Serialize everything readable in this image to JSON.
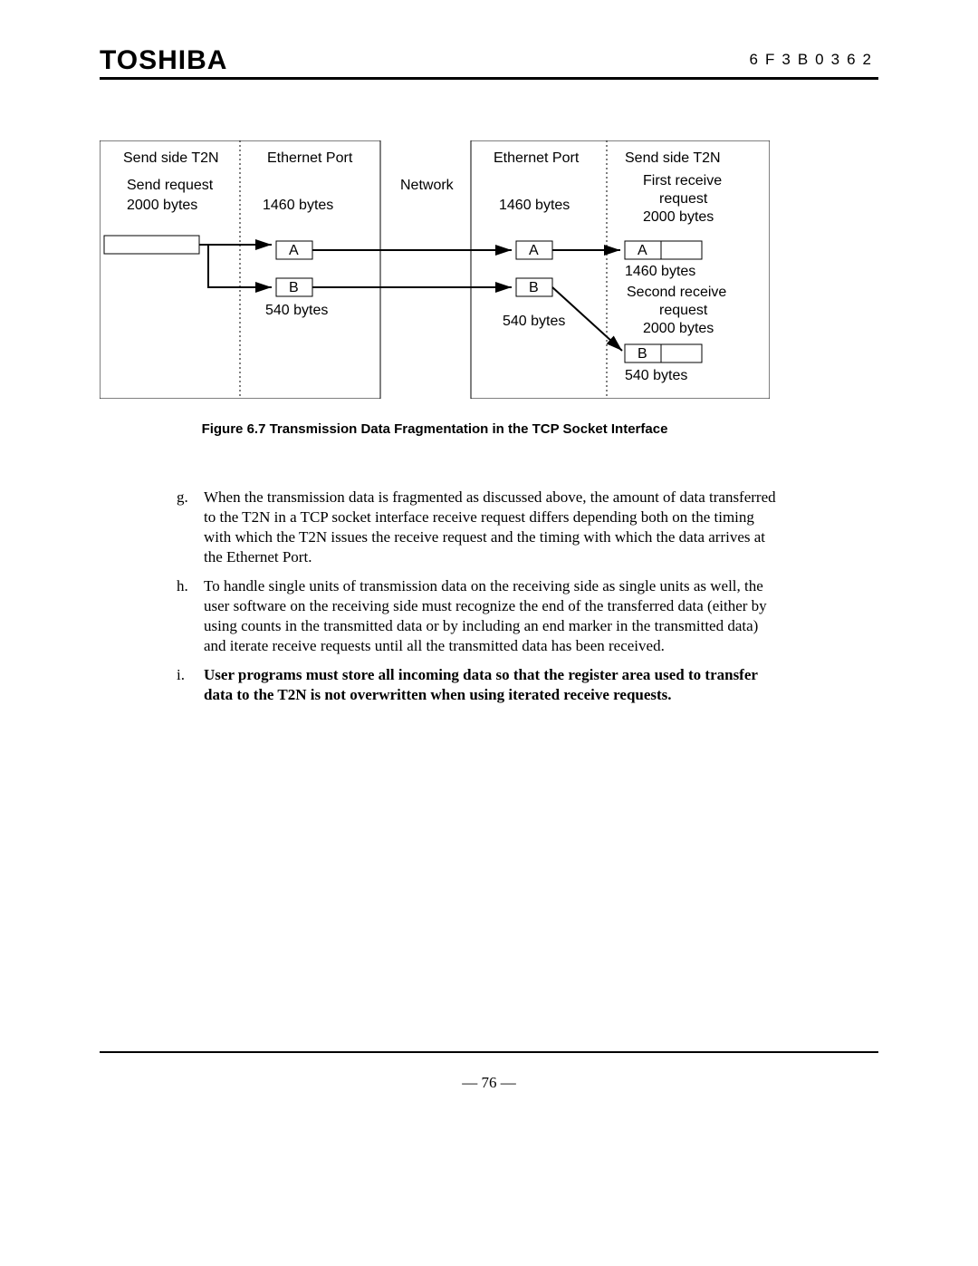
{
  "header": {
    "brand": "TOSHIBA",
    "docnum": "6F3B0362"
  },
  "footer": {
    "pagenum": "—  76  —"
  },
  "caption": "Figure 6.7    Transmission Data Fragmentation in the TCP Socket Interface",
  "diagram": {
    "left": {
      "topLeft1": "Send side T2N",
      "topLeft2": "Send request",
      "topLeft3": "2000 bytes",
      "topRight1": "Ethernet Port",
      "midLabel": "1460 bytes",
      "boxA": "A",
      "boxB": "B",
      "botLabel": "540 bytes"
    },
    "center": {
      "network": "Network"
    },
    "right": {
      "topLeft1": "Ethernet Port",
      "midLabel": "1460 bytes",
      "boxA": "A",
      "boxB": "B",
      "botLabel": "540 bytes",
      "topRight1": "Send side T2N",
      "req1a": "First receive",
      "req1b": "request",
      "req1c": "2000 bytes",
      "recvA": "A",
      "recvALabel": "1460 bytes",
      "req2a": "Second receive",
      "req2b": "request",
      "req2c": "2000 bytes",
      "recvB": "B",
      "recvBLabel": "540 bytes"
    }
  },
  "paragraphs": {
    "g": {
      "marker": "g.",
      "text": "When the transmission data is fragmented as discussed above, the amount of data transferred to the T2N in a TCP socket interface receive request differs depending both on the timing with which the T2N issues the receive request and the timing with which the data arrives at the Ethernet Port."
    },
    "h": {
      "marker": "h.",
      "text": "To handle single units of transmission data on the receiving side as single units as well, the user software on the receiving side must recognize the end of the transferred data (either by using counts in the transmitted data or by including an end marker in the transmitted data) and iterate receive requests until all the transmitted data has been received."
    },
    "i": {
      "marker": "i.",
      "text": "User programs must store all incoming data so that the register area used to transfer data to the T2N is not overwritten when using iterated receive requests."
    }
  }
}
